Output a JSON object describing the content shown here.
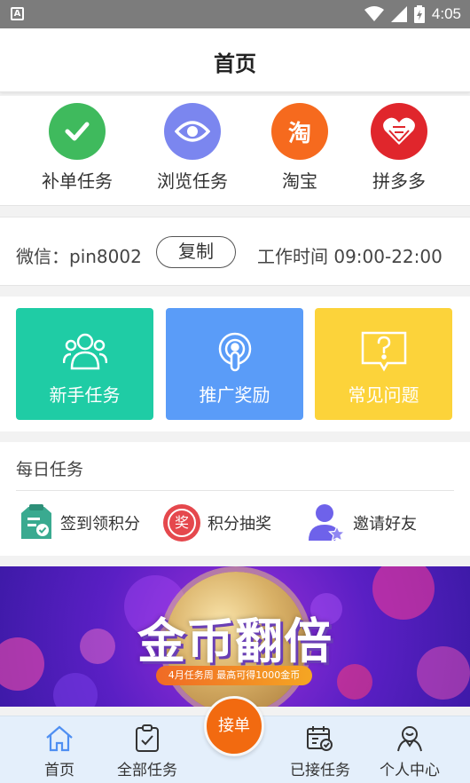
{
  "status_bar": {
    "time": "4:05",
    "app_badge": "A"
  },
  "header": {
    "title": "首页"
  },
  "quick_actions": [
    {
      "label": "补单任务",
      "icon": "check-icon",
      "color": "#3fba5d"
    },
    {
      "label": "浏览任务",
      "icon": "eye-icon",
      "color": "#7b86ef"
    },
    {
      "label": "淘宝",
      "icon": "taobao-icon",
      "color": "#f66a1e",
      "glyph": "淘"
    },
    {
      "label": "拼多多",
      "icon": "pinduoduo-icon",
      "color": "#e0262c"
    }
  ],
  "wechat": {
    "label": "微信：pin8002",
    "copy_button": "复制",
    "work_time": "工作时间  09:00-22:00"
  },
  "feature_cards": [
    {
      "label": "新手任务",
      "icon": "users-icon",
      "color": "#1fcca5"
    },
    {
      "label": "推广奖励",
      "icon": "broadcast-icon",
      "color": "#5a9cf8"
    },
    {
      "label": "常见问题",
      "icon": "question-icon",
      "color": "#fcd33a"
    }
  ],
  "daily_tasks": {
    "title": "每日任务",
    "items": [
      {
        "label": "签到领积分",
        "icon": "clipboard-check-icon",
        "color": "#3aaa90"
      },
      {
        "label": "积分抽奖",
        "icon": "lottery-icon",
        "color": "#e5484d",
        "glyph": "奖"
      },
      {
        "label": "邀请好友",
        "icon": "invite-friend-icon",
        "color": "#6e62ea"
      }
    ]
  },
  "banner": {
    "title": "金币翻倍",
    "subtitle": "4月任务周 最高可得1000金币"
  },
  "tab_bar": {
    "items": [
      {
        "label": "首页",
        "icon": "home-icon"
      },
      {
        "label": "全部任务",
        "icon": "clipboard-icon"
      },
      {
        "label": "已接任务",
        "icon": "calendar-icon"
      },
      {
        "label": "个人中心",
        "icon": "user-center-icon"
      }
    ],
    "center_button": "接单"
  }
}
